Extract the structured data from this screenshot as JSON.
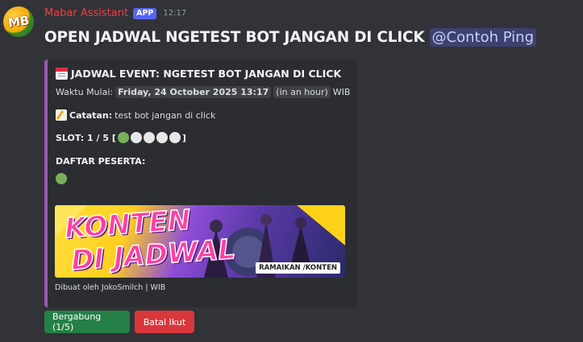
{
  "message": {
    "username": "Mabar Assistant",
    "app_badge": "APP",
    "timestamp": "12:17",
    "avatar_text": "MB",
    "title": "OPEN JADWAL NGETEST BOT JANGAN DI CLICK",
    "mention": "@Contoh Ping"
  },
  "embed": {
    "accent_color": "#9b59b6",
    "title": "JADWAL EVENT: NGETEST BOT JANGAN DI CLICK",
    "start_label": "Waktu Mulai:",
    "start_datetime": "Friday, 24 October 2025 13:17",
    "start_relative": "in an hour",
    "start_tz": "WIB",
    "note_label": "Catatan:",
    "note_text": "test bot jangan di click",
    "slot_label": "SLOT: 1 / 5 [",
    "slot_close": "]",
    "slots_filled": 1,
    "slots_total": 5,
    "participants_label": "DAFTAR PESERTA:",
    "banner_line1": "KONTEN",
    "banner_line2": "DI JADWAL",
    "banner_cta": "RAMAIKAN /KONTEN",
    "footer": "Dibuat oleh JokoSmilch | WIB"
  },
  "buttons": {
    "join": "Bergabung (1/5)",
    "cancel": "Batal Ikut"
  },
  "colors": {
    "username": "#f23f43",
    "join_button": "#248046",
    "cancel_button": "#da373c"
  }
}
